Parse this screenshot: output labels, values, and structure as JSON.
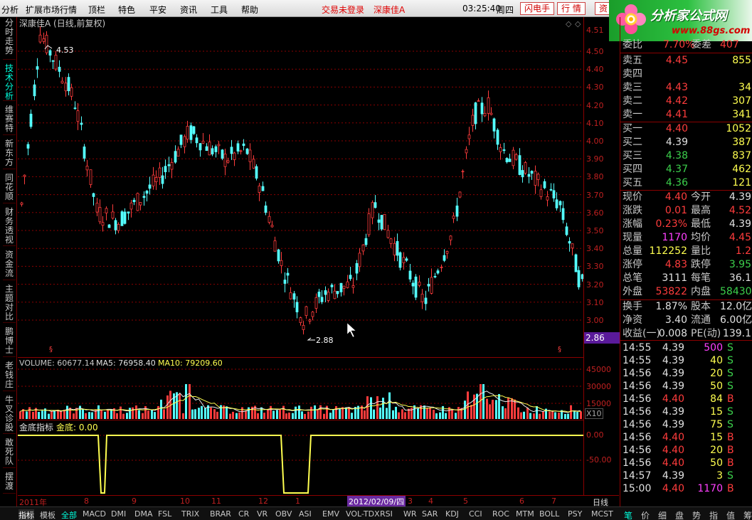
{
  "menubar": {
    "items": [
      "分析",
      "扩展市场行情",
      "顶栏",
      "特色",
      "平安",
      "资讯",
      "工具",
      "帮助"
    ],
    "status_login": "交易未登录",
    "stock_link": "深康佳A",
    "time": "03:25:40",
    "weekday": "周四",
    "buttons": [
      "闪电手",
      "行 情",
      "资"
    ]
  },
  "logo": {
    "title": "分析家公式网",
    "url": "www.88gs.com"
  },
  "chart": {
    "title": "深康佳A (日线,前复权)",
    "high_label": "4.53",
    "low_label": "2.88",
    "last_price_tag": "2.86",
    "price_ticks": [
      "4.50",
      "4.40",
      "4.30",
      "4.20",
      "4.10",
      "4.00",
      "3.90",
      "3.80",
      "3.70",
      "3.60",
      "3.50",
      "3.40",
      "3.30",
      "3.20",
      "3.10",
      "3.00"
    ],
    "overlay_ticks": [
      "4.51",
      "4.56"
    ]
  },
  "volume": {
    "label": "VOLUME: 60677.14",
    "ma5": "MA5: 76958.40",
    "ma10": "MA10: 79209.60",
    "ticks": [
      "45000",
      "30000",
      "15000"
    ],
    "unit": "X10"
  },
  "indicator": {
    "name": "金底指标",
    "value_label": "金底: 0.00",
    "ticks": [
      "0.00",
      "-50.00"
    ]
  },
  "date_axis": {
    "start": "2011年",
    "months": [
      "8",
      "9",
      "10",
      "11",
      "12",
      "1",
      "3",
      "4",
      "5",
      "6",
      "7"
    ],
    "cursor_date": "2012/02/09/四",
    "period": "日线"
  },
  "left_tabs": [
    "分时走势",
    "技术分析",
    "维赛特",
    "新东方",
    "同花顺",
    "财务透视",
    "资金流",
    "主题对比",
    "鹏博士",
    "老钱庄",
    "牛叉诊股",
    "敢死队",
    "摆渡"
  ],
  "bottom_tabs": [
    "指标",
    "模板",
    "全部",
    "MACD",
    "DMI",
    "DMA",
    "FSL",
    "TRIX",
    "BRAR",
    "CR",
    "VR",
    "OBV",
    "ASI",
    "EMV",
    "VOL-TDX",
    "RSI",
    "WR",
    "SAR",
    "KDJ",
    "CCI",
    "ROC",
    "MTM",
    "BOLL",
    "PSY",
    "MCST"
  ],
  "right_tabs": [
    "笔",
    "价",
    "细",
    "盘",
    "势",
    "指",
    "值",
    "筹"
  ],
  "quote": {
    "wb": [
      "委比",
      "7.70%",
      "委差",
      "407"
    ],
    "sell": [
      [
        "卖五",
        "4.45",
        "855"
      ],
      [
        "卖四",
        "",
        ""
      ],
      [
        "卖三",
        "4.43",
        "34"
      ],
      [
        "卖二",
        "4.42",
        "307"
      ],
      [
        "卖一",
        "4.41",
        "341"
      ]
    ],
    "buy": [
      [
        "买一",
        "4.40",
        "1052"
      ],
      [
        "买二",
        "4.39",
        "387"
      ],
      [
        "买三",
        "4.38",
        "837"
      ],
      [
        "买四",
        "4.37",
        "462"
      ],
      [
        "买五",
        "4.36",
        "121"
      ]
    ],
    "stats": [
      [
        "现价",
        "4.40",
        "今开",
        "4.39"
      ],
      [
        "涨跌",
        "0.01",
        "最高",
        "4.52"
      ],
      [
        "涨幅",
        "0.23%",
        "最低",
        "4.39"
      ],
      [
        "现量",
        "1170",
        "均价",
        "4.45"
      ],
      [
        "总量",
        "112252",
        "量比",
        "1.2"
      ],
      [
        "涨停",
        "4.83",
        "跌停",
        "3.95"
      ],
      [
        "总笔",
        "3111",
        "每笔",
        "36.1"
      ],
      [
        "外盘",
        "53822",
        "内盘",
        "58430"
      ]
    ],
    "fin": [
      [
        "换手",
        "1.87%",
        "股本",
        "12.0亿"
      ],
      [
        "净资",
        "3.40",
        "流通",
        "6.00亿"
      ],
      [
        "收益(一)",
        "0.008",
        "PE(动)",
        "139.1"
      ]
    ],
    "ticks": [
      [
        "14:55",
        "4.39",
        "500",
        "S"
      ],
      [
        "14:55",
        "4.39",
        "40",
        "S"
      ],
      [
        "14:56",
        "4.39",
        "20",
        "S"
      ],
      [
        "14:56",
        "4.39",
        "50",
        "S"
      ],
      [
        "14:56",
        "4.40",
        "84",
        "B"
      ],
      [
        "14:56",
        "4.39",
        "15",
        "S"
      ],
      [
        "14:56",
        "4.39",
        "75",
        "S"
      ],
      [
        "14:56",
        "4.40",
        "15",
        "B"
      ],
      [
        "14:56",
        "4.40",
        "20",
        "B"
      ],
      [
        "14:56",
        "4.40",
        "50",
        "B"
      ],
      [
        "14:57",
        "4.39",
        "3",
        "S"
      ],
      [
        "15:00",
        "4.40",
        "1170",
        "B"
      ]
    ]
  },
  "colors": {
    "up": "#ff3c3c",
    "down": "#54ffff",
    "bg": "#000000",
    "grid": "#8b0000",
    "yellow": "#ffff50",
    "purple": "#ff40ff",
    "green": "#3cd04c"
  }
}
